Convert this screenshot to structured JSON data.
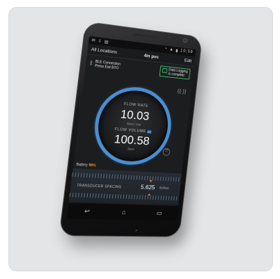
{
  "status": {
    "time": "10:59"
  },
  "appbar": {
    "left": "All Locations",
    "title": "4in pvc",
    "right": "Edit"
  },
  "ble": {
    "line1": "BLE Connection",
    "line2": "Press Exit BTO"
  },
  "logging": {
    "line1": "Data Logging",
    "line2": "is complete"
  },
  "gauge": {
    "flow_rate_label": "FLOW RATE",
    "flow_rate_value": "10.03",
    "flow_rate_unit": "liters / min",
    "flow_volume_label": "FLOW VOLUME",
    "flow_volume_value": "100.58",
    "flow_volume_unit": "liters"
  },
  "battery": {
    "label": "Battery",
    "percent": "98%"
  },
  "transducer": {
    "label": "TRANSDUCER SPACING",
    "value": "5.625",
    "unit": "inches"
  },
  "colors": {
    "accent": "#4b8fd0",
    "logging": "#3db86a",
    "battery": "#f28b1a"
  },
  "icons": {
    "status": [
      "notification-icon",
      "wifi-icon",
      "signal-icon",
      "battery-icon"
    ],
    "nav": [
      "back-icon",
      "home-icon",
      "recent-apps-icon"
    ]
  }
}
